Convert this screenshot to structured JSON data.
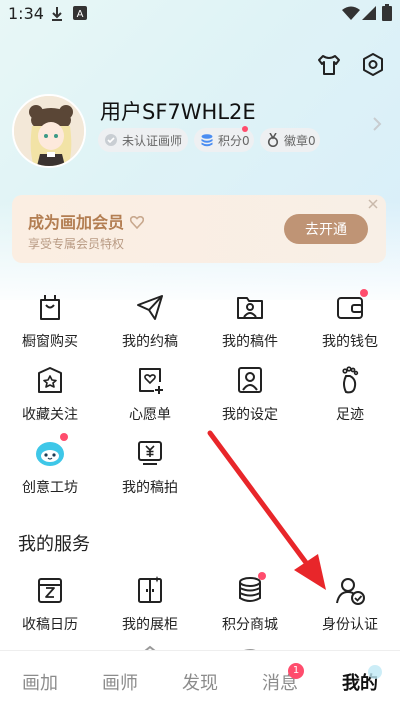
{
  "status_bar": {
    "time": "1:34"
  },
  "profile": {
    "username": "用户SF7WHL2E",
    "chips": {
      "verify": "未认证画师",
      "points": "积分0",
      "badges": "徽章0"
    }
  },
  "vip": {
    "title": "成为画加会员",
    "subtitle": "享受专属会员特权",
    "button": "去开通"
  },
  "menu": [
    {
      "label": "橱窗购买",
      "icon": "shopping-bag-icon"
    },
    {
      "label": "我的约稿",
      "icon": "paper-plane-icon"
    },
    {
      "label": "我的稿件",
      "icon": "folder-person-icon"
    },
    {
      "label": "我的钱包",
      "icon": "wallet-icon"
    },
    {
      "label": "收藏关注",
      "icon": "star-box-icon"
    },
    {
      "label": "心愿单",
      "icon": "heart-list-icon"
    },
    {
      "label": "我的设定",
      "icon": "person-card-icon"
    },
    {
      "label": "足迹",
      "icon": "footprint-icon"
    },
    {
      "label": "创意工坊",
      "icon": "workshop-mascot-icon"
    },
    {
      "label": "我的稿拍",
      "icon": "yen-card-icon"
    }
  ],
  "services": {
    "title": "我的服务",
    "items": [
      {
        "label": "收稿日历",
        "icon": "calendar-icon"
      },
      {
        "label": "我的展柜",
        "icon": "showcase-icon"
      },
      {
        "label": "积分商城",
        "icon": "coins-stack-icon"
      },
      {
        "label": "身份认证",
        "icon": "identity-check-icon"
      }
    ]
  },
  "bottom_nav": {
    "tabs": [
      "画加",
      "画师",
      "发现",
      "消息",
      "我的"
    ],
    "message_badge": "1",
    "active": "我的"
  },
  "colors": {
    "accent_red": "#ff4d6d",
    "vip_brown": "#b37e52",
    "annotation_arrow": "#e8262a"
  }
}
